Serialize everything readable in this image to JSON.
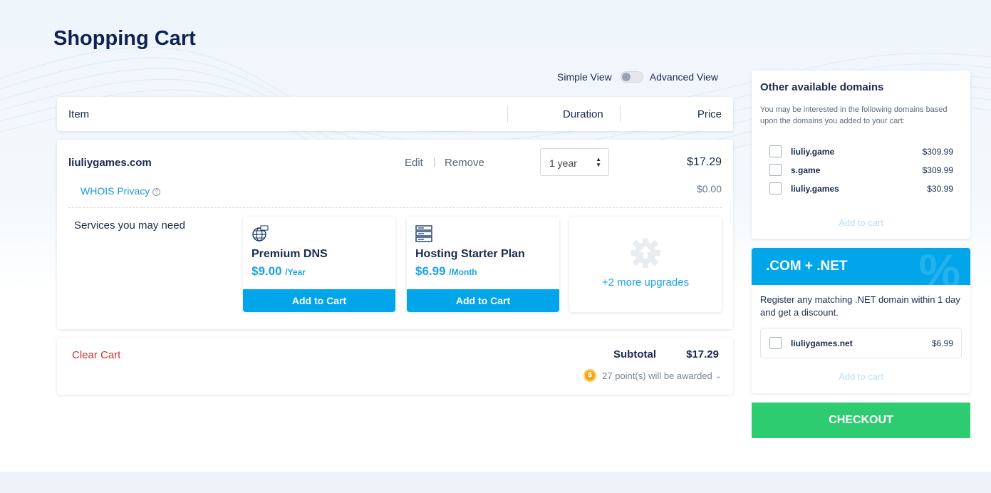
{
  "page": {
    "title": "Shopping Cart"
  },
  "view_toggle": {
    "left_label": "Simple View",
    "right_label": "Advanced View"
  },
  "table_header": {
    "item": "Item",
    "duration": "Duration",
    "price": "Price"
  },
  "cart_item": {
    "domain": "liuliygames.com",
    "edit_label": "Edit",
    "remove_label": "Remove",
    "duration": "1 year",
    "price": "$17.29",
    "whois_label": "WHOIS Privacy",
    "whois_price": "$0.00"
  },
  "services": {
    "label": "Services you may need",
    "items": [
      {
        "name": "Premium DNS",
        "price": "$9.00",
        "period": "/Year",
        "button": "Add to Cart",
        "icon": "globe-icon"
      },
      {
        "name": "Hosting Starter Plan",
        "price": "$6.99",
        "period": "/Month",
        "button": "Add to Cart",
        "icon": "server-icon"
      }
    ],
    "more": "+2 more upgrades"
  },
  "totals": {
    "clear_cart": "Clear Cart",
    "subtotal_label": "Subtotal",
    "subtotal_value": "$17.29",
    "points_text": "27 point(s) will be awarded"
  },
  "other_domains": {
    "title": "Other available domains",
    "description": "You may be interested in the following domains based upon the domains you added to your cart:",
    "items": [
      {
        "name": "liuliy.game",
        "price": "$309.99"
      },
      {
        "name": "s.game",
        "price": "$309.99"
      },
      {
        "name": "liuliy.games",
        "price": "$30.99"
      }
    ],
    "add_label": "Add to cart"
  },
  "promo": {
    "title": ".COM + .NET",
    "description": "Register any matching .NET domain within 1 day and get a discount.",
    "domain": "liuliygames.net",
    "price": "$6.99",
    "add_label": "Add to cart"
  },
  "checkout_label": "CHECKOUT",
  "colors": {
    "accent": "#00a5ea",
    "checkout": "#2ecc71",
    "danger": "#d3342a",
    "title": "#0f2350"
  }
}
